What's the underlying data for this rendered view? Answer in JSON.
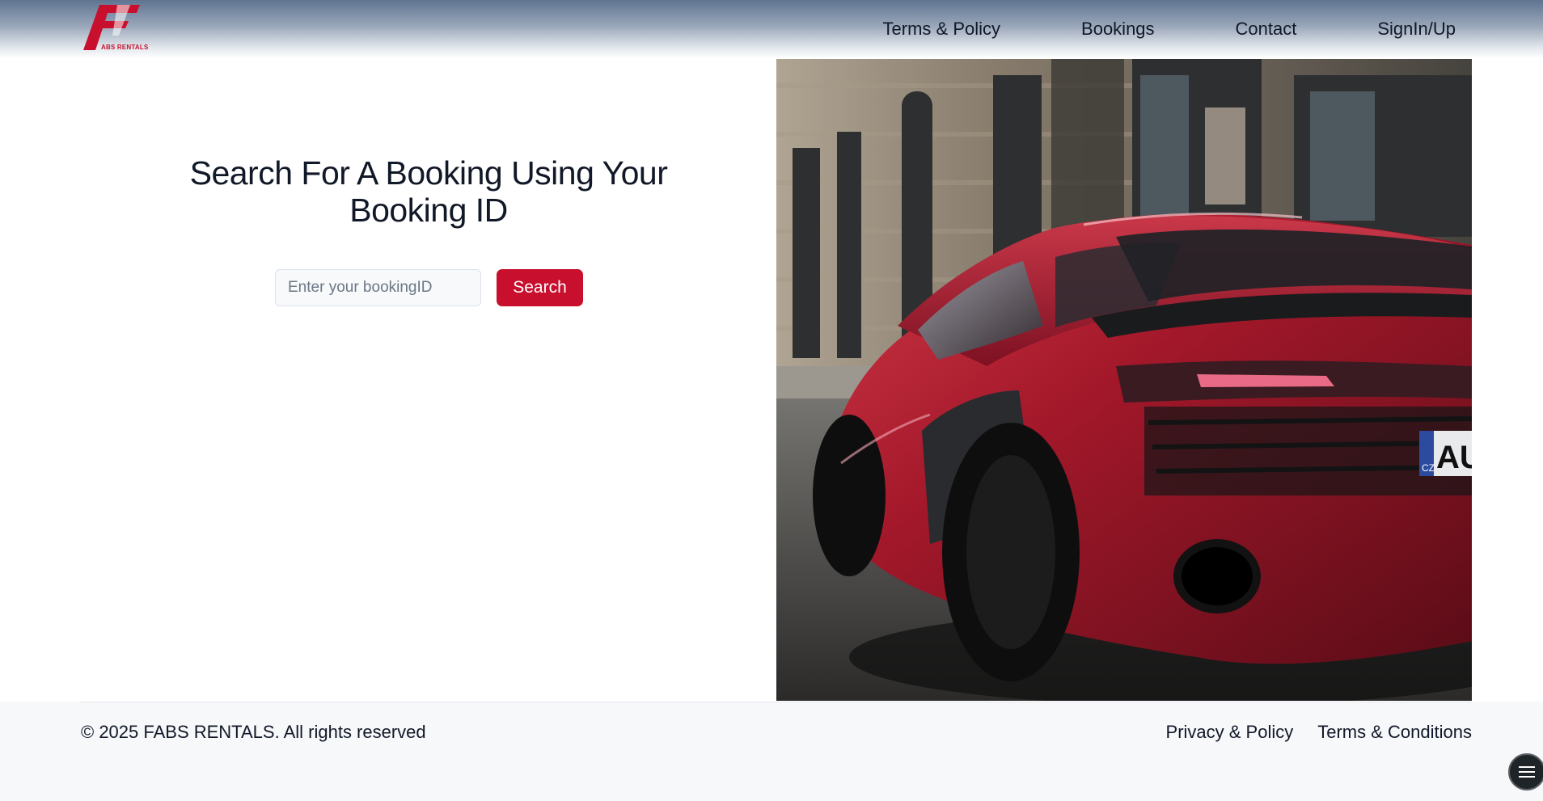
{
  "brand": {
    "logo_letter": "F",
    "logo_text": "ABS RENTALS",
    "accent_color": "#c8102e"
  },
  "nav": {
    "items": [
      {
        "label": "Terms & Policy"
      },
      {
        "label": "Bookings"
      },
      {
        "label": "Contact"
      },
      {
        "label": "SignIn/Up"
      }
    ]
  },
  "search": {
    "title": "Search For A Booking Using Your Booking ID",
    "placeholder": "Enter your bookingID",
    "button_label": "Search"
  },
  "hero": {
    "image": "red-sports-car-icon",
    "plate_country": "CZ",
    "plate_text": "AU"
  },
  "footer": {
    "copyright": "© 2025 FABS RENTALS. All rights reserved",
    "links": [
      {
        "label": "Privacy & Policy"
      },
      {
        "label": "Terms & Conditions"
      }
    ]
  },
  "floating_menu": {
    "icon": "hamburger-menu-icon"
  }
}
